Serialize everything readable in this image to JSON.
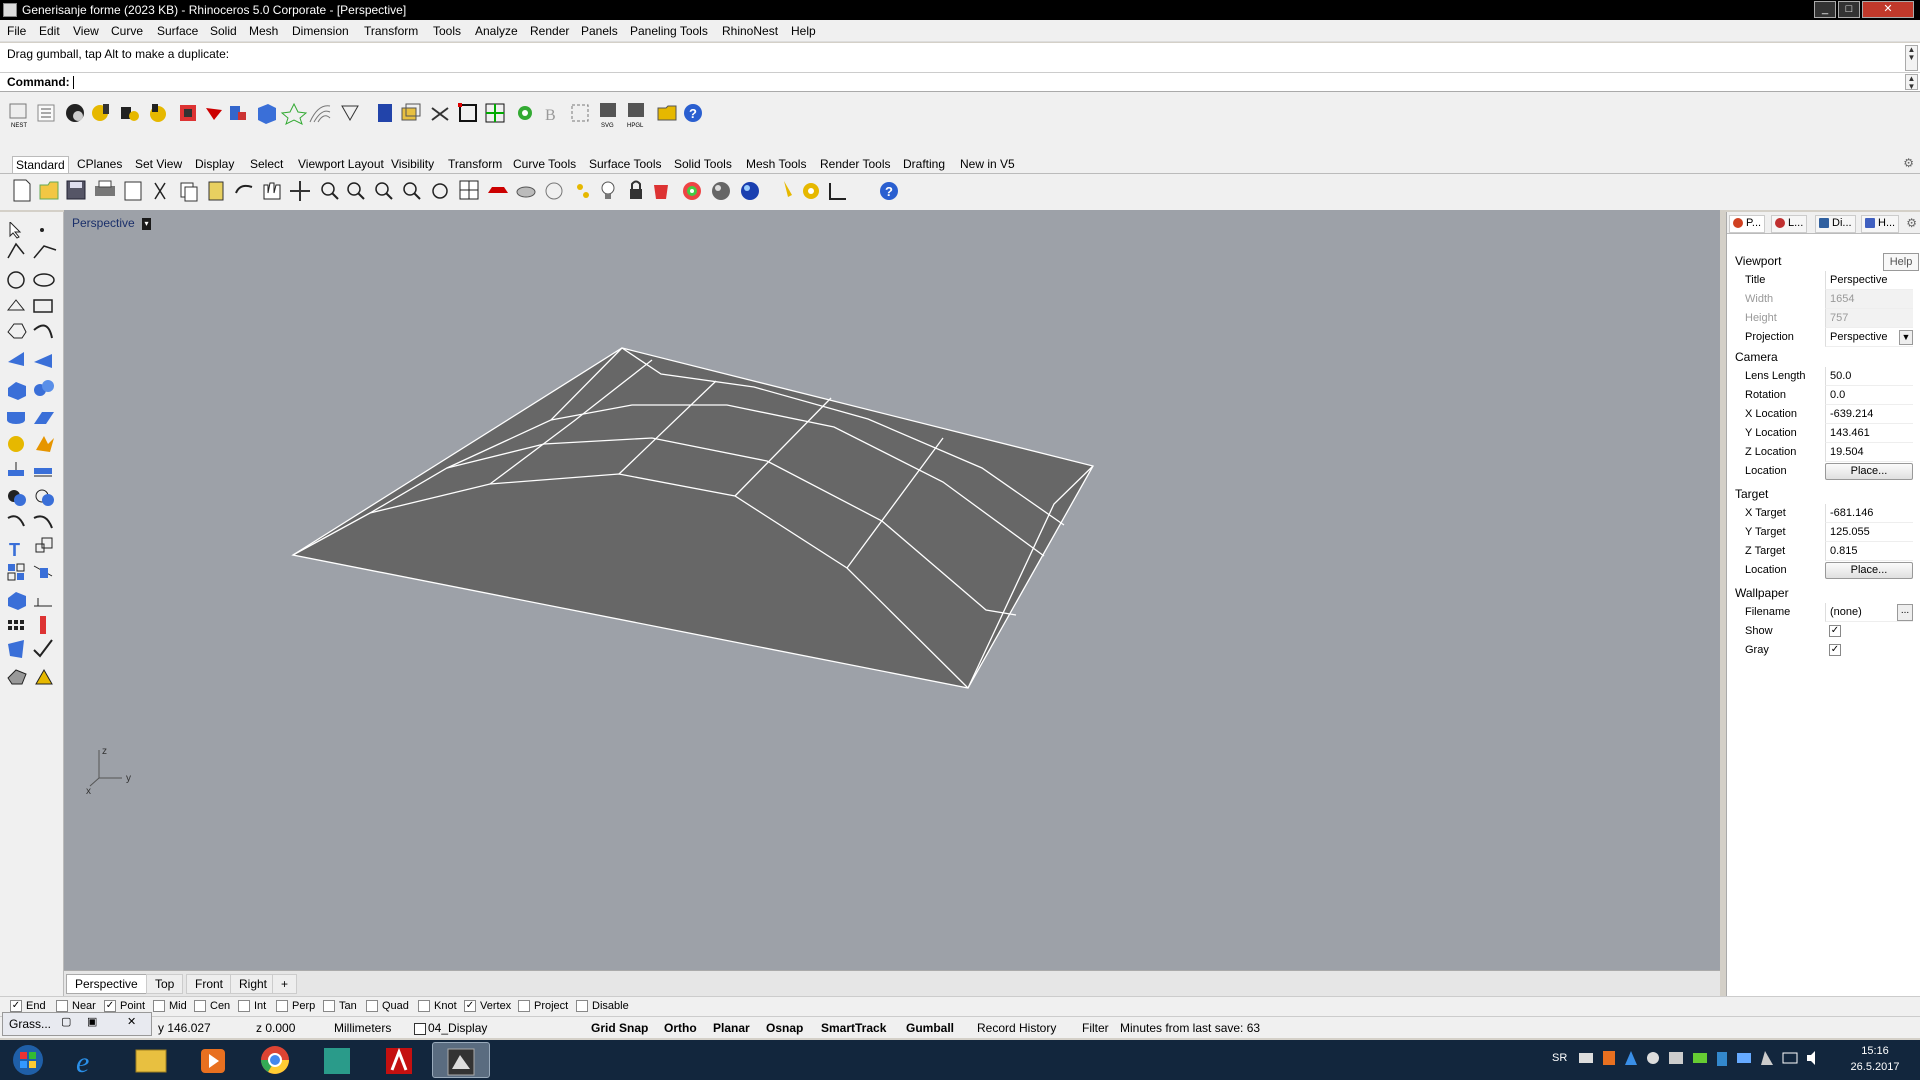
{
  "window": {
    "title": "Generisanje forme (2023 KB) - Rhinoceros  5.0 Corporate - [Perspective]"
  },
  "menu": [
    "File",
    "Edit",
    "View",
    "Curve",
    "Surface",
    "Solid",
    "Mesh",
    "Dimension",
    "Transform",
    "Tools",
    "Analyze",
    "Render",
    "Panels",
    "Paneling Tools",
    "RhinoNest",
    "Help"
  ],
  "history": {
    "text": "Drag gumball, tap Alt to make a duplicate:"
  },
  "command": {
    "label": "Command:",
    "value": ""
  },
  "toolbar1_icons": [
    "nest-icon",
    "list-icon",
    "rotate-icon",
    "tools-icon",
    "tools2-icon",
    "tools3-icon",
    "tools4-icon",
    "arrow-red-icon",
    "multi-icon",
    "cube-icon",
    "star-icon",
    "curves-icon",
    "arrow-icon",
    "blue-paint-icon",
    "layers-icon",
    "cut-icon",
    "select-frame-icon",
    "grid-icon",
    "gear-icon",
    "bold-b-icon",
    "frame-icon",
    "svg-export-icon",
    "hpgl-export-icon",
    "folder-open-icon",
    "help-icon"
  ],
  "tabs": [
    "Standard",
    "CPlanes",
    "Set View",
    "Display",
    "Select",
    "Viewport Layout",
    "Visibility",
    "Transform",
    "Curve Tools",
    "Surface Tools",
    "Solid Tools",
    "Mesh Tools",
    "Render Tools",
    "Drafting",
    "New in V5"
  ],
  "toolbar2_icons": [
    "new-icon",
    "open-icon",
    "save-icon",
    "print-icon",
    "import-icon",
    "cut-icon",
    "copy-icon",
    "paste-icon",
    "undo-icon",
    "pan-icon",
    "move-view-icon",
    "zoom-icon",
    "zoom-window-icon",
    "zoom-extents-icon",
    "zoom-selected-icon",
    "rotate-view-icon",
    "four-views-icon",
    "car-icon",
    "shaded-icon",
    "circle-icon",
    "points-icon",
    "bulb-icon",
    "lock-icon",
    "material-icon",
    "color-wheel-icon",
    "render-sphere-icon",
    "blue-sphere-icon",
    "light-icon",
    "settings-icon",
    "dimension-icon",
    "help-icon"
  ],
  "viewport": {
    "title": "Perspective",
    "axis_z": "z",
    "axis_x": "x",
    "axis_y": "y"
  },
  "viewport_tabs": [
    "Perspective",
    "Top",
    "Front",
    "Right"
  ],
  "right_panel": {
    "tabs": [
      {
        "label": "P...",
        "color": "#d04020"
      },
      {
        "label": "L...",
        "color": "#c03030"
      },
      {
        "label": "Di...",
        "color": "#3060a0"
      },
      {
        "label": "H...",
        "color": "#4060c0"
      }
    ],
    "help_label": "Help",
    "sections": {
      "viewport": "Viewport",
      "camera": "Camera",
      "target": "Target",
      "wallpaper": "Wallpaper"
    },
    "viewport_rows": [
      {
        "k": "Title",
        "v": "Perspective"
      },
      {
        "k": "Width",
        "v": "1654"
      },
      {
        "k": "Height",
        "v": "757"
      },
      {
        "k": "Projection",
        "v": "Perspective"
      }
    ],
    "camera_rows": [
      {
        "k": "Lens Length",
        "v": "50.0"
      },
      {
        "k": "Rotation",
        "v": "0.0"
      },
      {
        "k": "X Location",
        "v": "-639.214"
      },
      {
        "k": "Y Location",
        "v": "143.461"
      },
      {
        "k": "Z Location",
        "v": "19.504"
      },
      {
        "k": "Location",
        "v": "Place..."
      }
    ],
    "target_rows": [
      {
        "k": "X Target",
        "v": "-681.146"
      },
      {
        "k": "Y Target",
        "v": "125.055"
      },
      {
        "k": "Z Target",
        "v": "0.815"
      },
      {
        "k": "Location",
        "v": "Place..."
      }
    ],
    "wallpaper_rows": [
      {
        "k": "Filename",
        "v": "(none)"
      },
      {
        "k": "Show",
        "v": "checked"
      },
      {
        "k": "Gray",
        "v": "checked"
      }
    ],
    "ellipsis": "..."
  },
  "osnaps": [
    {
      "label": "End",
      "checked": true
    },
    {
      "label": "Near",
      "checked": false
    },
    {
      "label": "Point",
      "checked": true
    },
    {
      "label": "Mid",
      "checked": false
    },
    {
      "label": "Cen",
      "checked": false
    },
    {
      "label": "Int",
      "checked": false
    },
    {
      "label": "Perp",
      "checked": false
    },
    {
      "label": "Tan",
      "checked": false
    },
    {
      "label": "Quad",
      "checked": false
    },
    {
      "label": "Knot",
      "checked": false
    },
    {
      "label": "Vertex",
      "checked": true
    },
    {
      "label": "Project",
      "checked": false
    },
    {
      "label": "Disable",
      "checked": false
    }
  ],
  "status": {
    "y": "y 146.027",
    "z": "z 0.000",
    "units": "Millimeters",
    "layer": "04_Display",
    "grid_snap": "Grid Snap",
    "ortho": "Ortho",
    "planar": "Planar",
    "osnap": "Osnap",
    "smarttrack": "SmartTrack",
    "gumball": "Gumball",
    "record_history": "Record History",
    "filter": "Filter",
    "minutes": "Minutes from last save: 63"
  },
  "minimized": {
    "label": "Grass..."
  },
  "taskbar": {
    "lang": "SR",
    "time": "15:16",
    "date": "26.5.2017",
    "apps": [
      "windows-start-icon",
      "internet-explorer-icon",
      "file-explorer-icon",
      "media-player-icon",
      "chrome-icon",
      "app-icon",
      "autocad-icon",
      "rhino-icon"
    ]
  }
}
